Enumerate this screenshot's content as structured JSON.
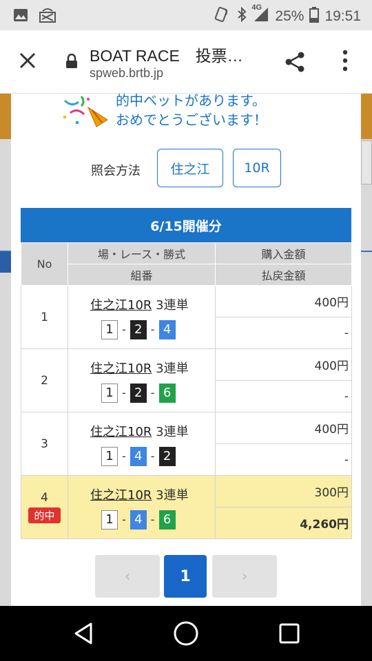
{
  "status_bar": {
    "network": "4G",
    "battery": "25%",
    "time": "19:51"
  },
  "browser": {
    "title": "BOAT RACE　投票…",
    "url": "spweb.brtb.jp"
  },
  "message": {
    "line1": "的中ベットがあります。",
    "line2": "おめでとうございます！"
  },
  "inquiry": {
    "label": "照会方法",
    "venue_button": "住之江",
    "race_button": "10R"
  },
  "date_header": "6/15開催分",
  "table": {
    "headers": {
      "no": "No",
      "venue_race_type": "場・レース・勝式",
      "combo": "組番",
      "purchase": "購入金額",
      "payout": "払戻金額"
    },
    "rows": [
      {
        "no": "1",
        "venue": "住之江10R",
        "type": "3連単",
        "combo": [
          "1",
          "2",
          "4"
        ],
        "purchase": "400円",
        "payout": "-",
        "hit": false
      },
      {
        "no": "2",
        "venue": "住之江10R",
        "type": "3連単",
        "combo": [
          "1",
          "2",
          "6"
        ],
        "purchase": "400円",
        "payout": "-",
        "hit": false
      },
      {
        "no": "3",
        "venue": "住之江10R",
        "type": "3連単",
        "combo": [
          "1",
          "4",
          "2"
        ],
        "purchase": "400円",
        "payout": "-",
        "hit": false
      },
      {
        "no": "4",
        "venue": "住之江10R",
        "type": "3連単",
        "combo": [
          "1",
          "4",
          "6"
        ],
        "purchase": "300円",
        "payout": "4,260円",
        "hit": true,
        "hit_label": "的中"
      }
    ]
  },
  "pager": {
    "prev": "‹",
    "current": "1",
    "next": "›"
  },
  "colors": {
    "accent": "#1a74c8",
    "hit_row": "#fbeea6",
    "hit_badge": "#e0332f"
  }
}
